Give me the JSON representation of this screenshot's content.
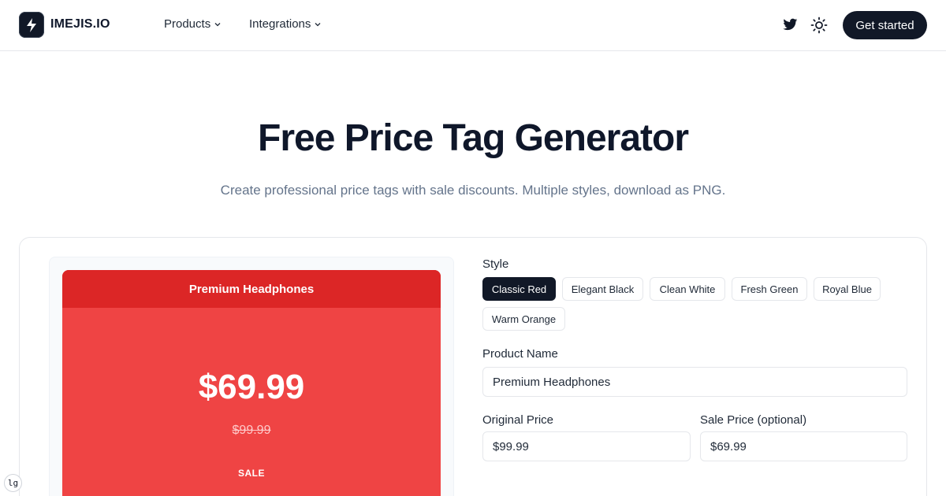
{
  "header": {
    "logo_text": "IMEJIS.IO",
    "nav": [
      {
        "label": "Products",
        "icon": "chevron-down-icon"
      },
      {
        "label": "Integrations",
        "icon": "chevron-down-icon"
      }
    ],
    "twitter_icon": "twitter-icon",
    "theme_icon": "sun-icon",
    "cta_label": "Get started"
  },
  "hero": {
    "title": "Free Price Tag Generator",
    "subtitle": "Create professional price tags with sale discounts. Multiple styles, download as PNG."
  },
  "preview": {
    "product_name": "Premium Headphones",
    "sale_price": "$69.99",
    "original_price": "$99.99",
    "badge": "SALE",
    "header_color": "#dc2626",
    "body_color": "#ef4444"
  },
  "form": {
    "style_label": "Style",
    "styles": [
      "Classic Red",
      "Elegant Black",
      "Clean White",
      "Fresh Green",
      "Royal Blue",
      "Warm Orange"
    ],
    "selected_style": "Classic Red",
    "product_name_label": "Product Name",
    "product_name_value": "Premium Headphones",
    "original_price_label": "Original Price",
    "original_price_value": "$99.99",
    "sale_price_label": "Sale Price (optional)",
    "sale_price_value": "$69.99"
  },
  "corner_badge": "lg",
  "colors": {
    "primary": "#111827",
    "muted_text": "#64748b",
    "border": "#e5e7eb"
  }
}
